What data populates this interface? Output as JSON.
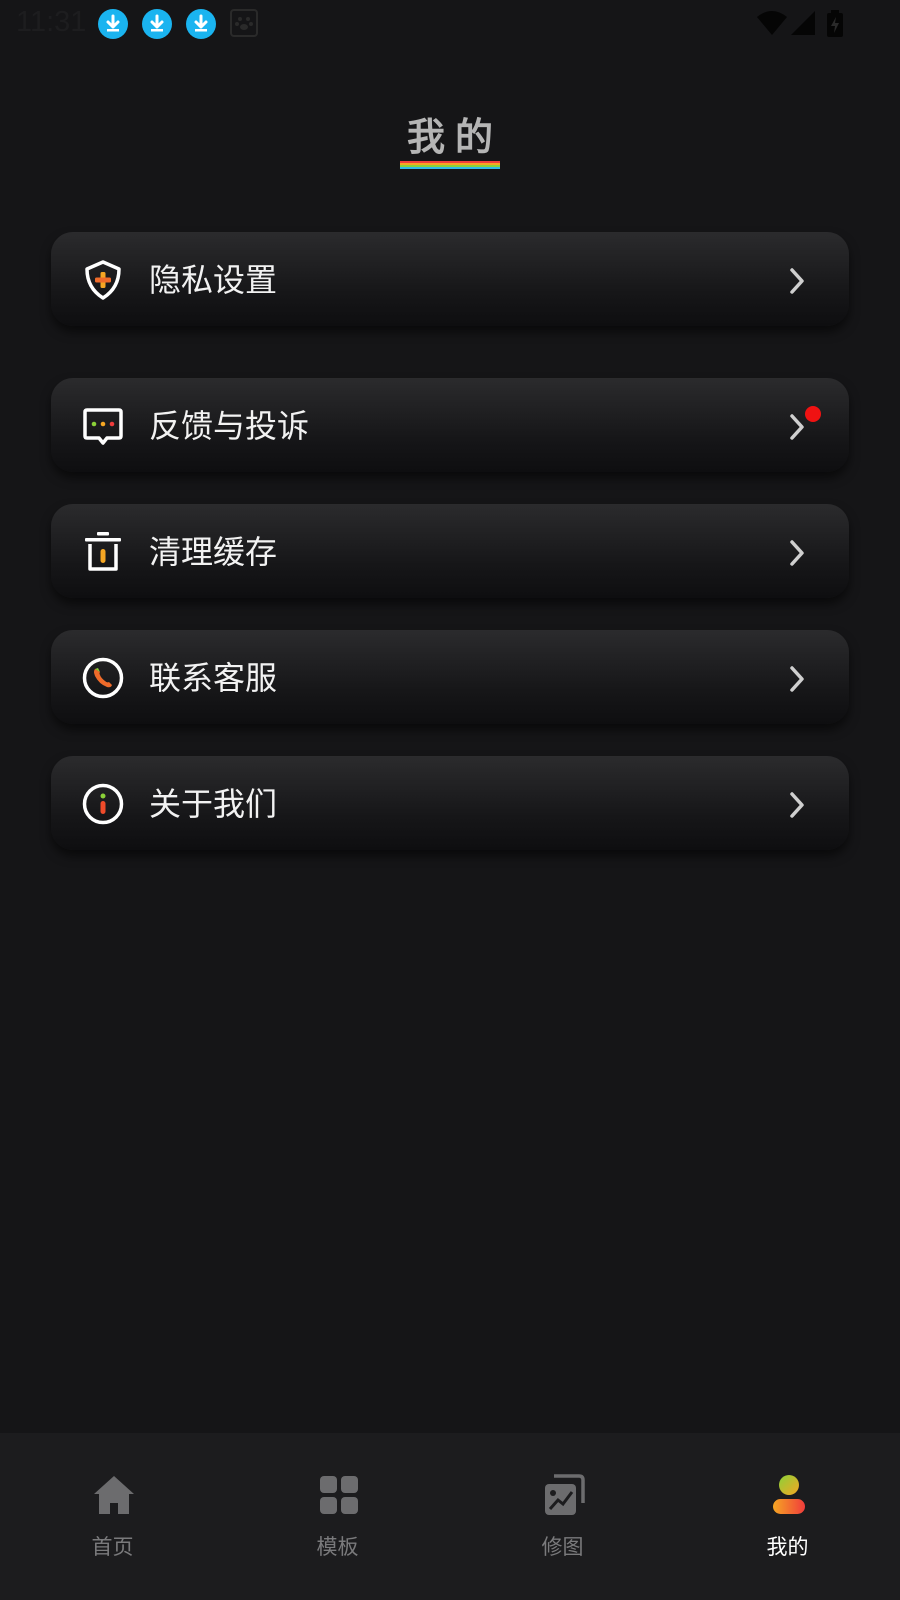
{
  "status_bar": {
    "time": "11:31"
  },
  "page": {
    "title": "我的"
  },
  "menu": [
    {
      "label": "隐私设置",
      "icon": "shield-plus-icon",
      "badge": false
    },
    {
      "label": "反馈与投诉",
      "icon": "feedback-chat-icon",
      "badge": true
    },
    {
      "label": "清理缓存",
      "icon": "trash-icon",
      "badge": false
    },
    {
      "label": "联系客服",
      "icon": "phone-icon",
      "badge": false
    },
    {
      "label": "关于我们",
      "icon": "info-icon",
      "badge": false
    }
  ],
  "bottom_nav": [
    {
      "label": "首页",
      "icon": "home-icon",
      "active": false
    },
    {
      "label": "模板",
      "icon": "grid-icon",
      "active": false
    },
    {
      "label": "修图",
      "icon": "photo-edit-icon",
      "active": false
    },
    {
      "label": "我的",
      "icon": "person-icon",
      "active": true
    }
  ],
  "colors": {
    "background": "#151517",
    "accent_red": "#f01212",
    "download_blue": "#1ab4f0",
    "inactive_nav": "#7a7a7c"
  }
}
